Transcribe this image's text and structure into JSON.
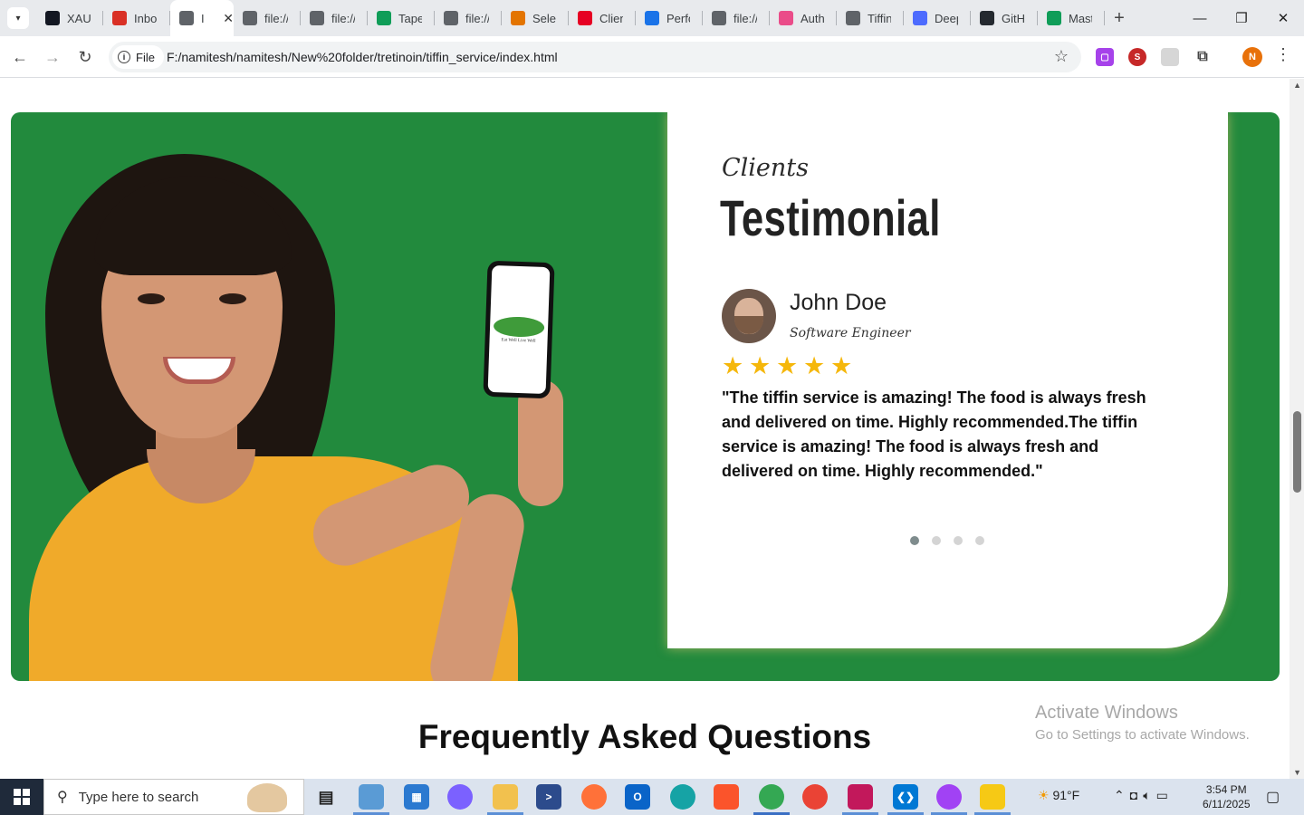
{
  "browser": {
    "tabs": [
      {
        "label": "XAU",
        "icon": "tradingview-icon",
        "color": "#131722"
      },
      {
        "label": "Inbo",
        "icon": "gmail-icon",
        "color": "#d93025"
      },
      {
        "label": "I",
        "icon": "globe-icon",
        "color": "#5f6368",
        "active": true
      },
      {
        "label": "file://",
        "icon": "globe-icon",
        "color": "#5f6368"
      },
      {
        "label": "file://",
        "icon": "globe-icon",
        "color": "#5f6368"
      },
      {
        "label": "Taper",
        "icon": "sheets-icon",
        "color": "#0f9d58"
      },
      {
        "label": "file://",
        "icon": "globe-icon",
        "color": "#5f6368"
      },
      {
        "label": "Selec",
        "icon": "puzzle-icon",
        "color": "#e37400"
      },
      {
        "label": "Clien",
        "icon": "pinterest-icon",
        "color": "#e60023"
      },
      {
        "label": "Perfo",
        "icon": "perf-icon",
        "color": "#1a73e8"
      },
      {
        "label": "file://",
        "icon": "globe-icon",
        "color": "#5f6368"
      },
      {
        "label": "Auth",
        "icon": "dribbble-icon",
        "color": "#ea4c89"
      },
      {
        "label": "Tiffin",
        "icon": "globe-icon",
        "color": "#5f6368"
      },
      {
        "label": "Deep",
        "icon": "deepseek-icon",
        "color": "#4d6bfe"
      },
      {
        "label": "GitH",
        "icon": "github-icon",
        "color": "#24292f"
      },
      {
        "label": "Mast",
        "icon": "sheets-icon",
        "color": "#0f9d58"
      }
    ],
    "site_chip_label": "File",
    "url": "F:/namitesh/namitesh/New%20folder/tretinoin/tiffin_service/index.html",
    "profile_initial": "N"
  },
  "testimonial": {
    "phone_tag": "Eat Well Live Well",
    "clients_label": "Clients",
    "title": "Testimonial",
    "person_name": "John Doe",
    "person_role": "Software Engineer",
    "rating": 5,
    "star_glyph": "★",
    "quote": "\"The tiffin service is amazing! The food is always fresh and delivered on time. Highly recommended.The tiffin service is amazing! The food is always fresh and delivered on time. Highly recommended.\"",
    "slides_total": 4,
    "active_slide": 1,
    "accent_green": "#228a3d",
    "star_color": "#f5b70b"
  },
  "faq": {
    "title": "Frequently Asked Questions"
  },
  "watermark": {
    "title": "Activate Windows",
    "subtitle": "Go to Settings to activate Windows."
  },
  "taskbar": {
    "search_placeholder": "Type here to search",
    "weather": "91°F",
    "time": "3:54 PM",
    "date": "6/11/2025"
  }
}
